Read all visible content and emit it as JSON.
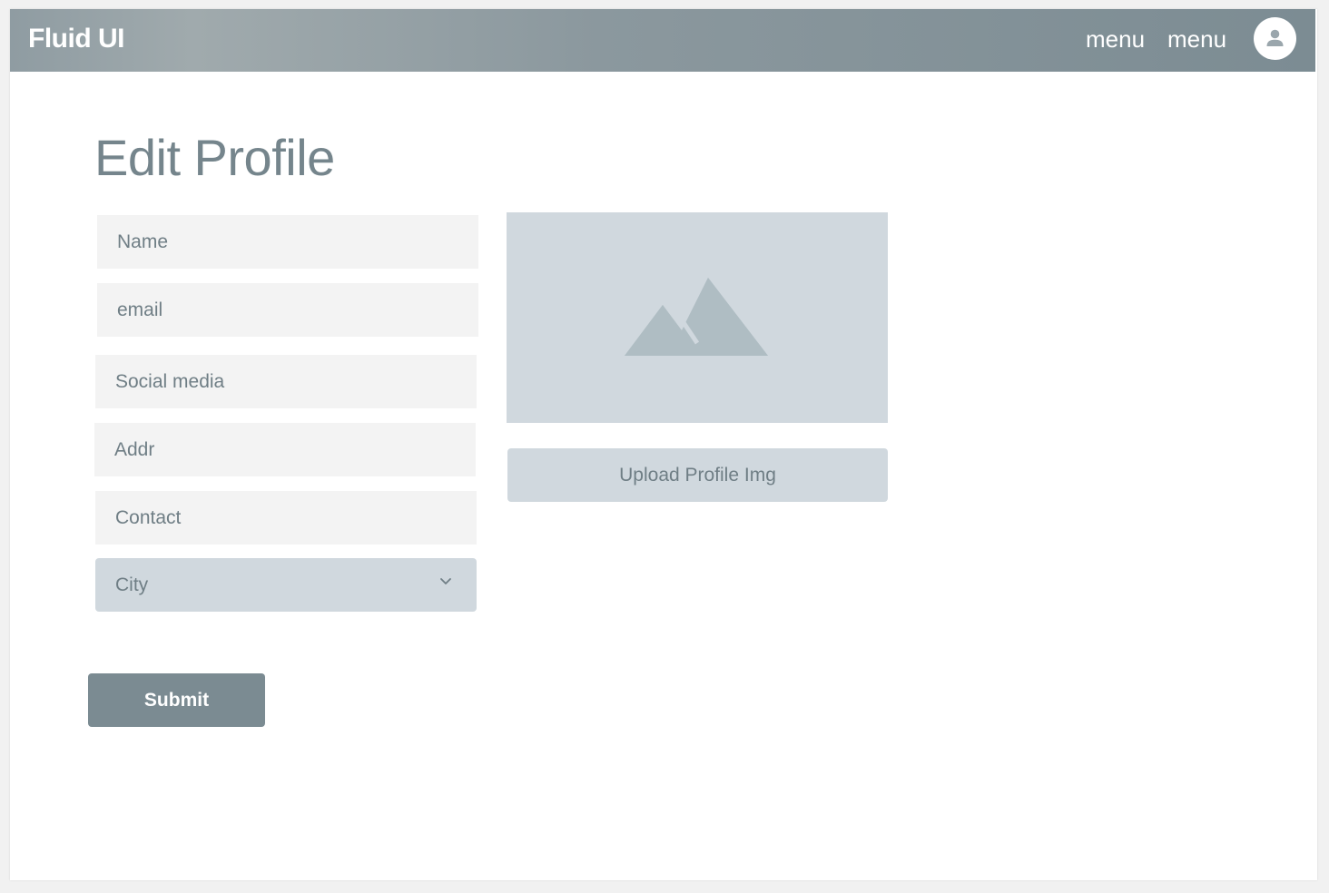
{
  "header": {
    "brand": "Fluid UI",
    "menu_items": [
      "menu",
      "menu"
    ],
    "avatar_icon": "user-icon"
  },
  "page": {
    "title": "Edit Profile"
  },
  "form": {
    "fields": [
      {
        "placeholder": "Name",
        "value": ""
      },
      {
        "placeholder": "email",
        "value": ""
      },
      {
        "placeholder": "Social media",
        "value": ""
      },
      {
        "placeholder": "Addr",
        "value": ""
      },
      {
        "placeholder": "Contact",
        "value": ""
      }
    ],
    "city_select": {
      "label": "City",
      "icon": "chevron-down-icon"
    },
    "submit_label": "Submit"
  },
  "profile_image": {
    "placeholder_icon": "image-placeholder-icon",
    "upload_label": "Upload Profile Img"
  },
  "colors": {
    "accent": "#7b8b92",
    "field_bg": "#f3f3f3",
    "select_bg": "#d0d8de",
    "text_muted": "#6f7e85"
  }
}
